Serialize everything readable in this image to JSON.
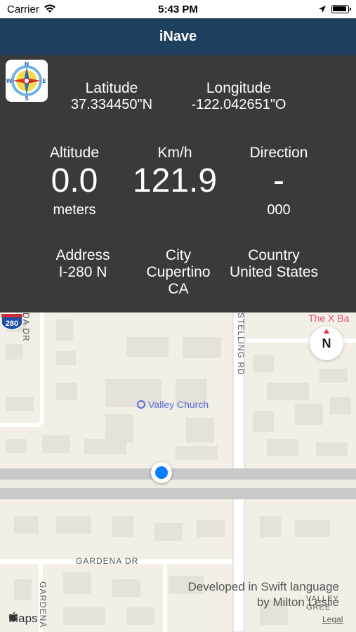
{
  "status_bar": {
    "carrier": "Carrier",
    "time": "5:43 PM"
  },
  "nav": {
    "title": "iNave"
  },
  "info": {
    "latitude_label": "Latitude",
    "latitude_value": "37.334450\"N",
    "longitude_label": "Longitude",
    "longitude_value": "-122.042651\"O",
    "altitude_label": "Altitude",
    "altitude_value": "0.0",
    "altitude_unit": "meters",
    "speed_label": "Km/h",
    "speed_value": "121.9",
    "direction_label": "Direction",
    "direction_value": "-",
    "direction_degrees": "000",
    "address_label": "Address",
    "address_value": "I-280 N",
    "city_label": "City",
    "city_value": "Cupertino",
    "state_value": "CA",
    "country_label": "Country",
    "country_value": "United States"
  },
  "map": {
    "poi_name": "Valley Church",
    "pin_partial": "The X Ba",
    "street_stelling": "STELLING RD",
    "street_gardena": "GARDENA DR",
    "street_gardena_vertical": "GARDENA",
    "street_partial_top": "DA DR",
    "street_valley_green": "VALLEY GREE",
    "highway_shield": "280",
    "compass_label": "N",
    "credit_line1": "Developed in Swift language",
    "credit_line2": "by Milton Leslie",
    "maps_logo": "Maps",
    "legal": "Legal",
    "colors": {
      "road_major": "#c9c9c9",
      "building": "#e4e1d9",
      "user_location": "#0a7cff",
      "poi": "#5b6fd9"
    }
  }
}
